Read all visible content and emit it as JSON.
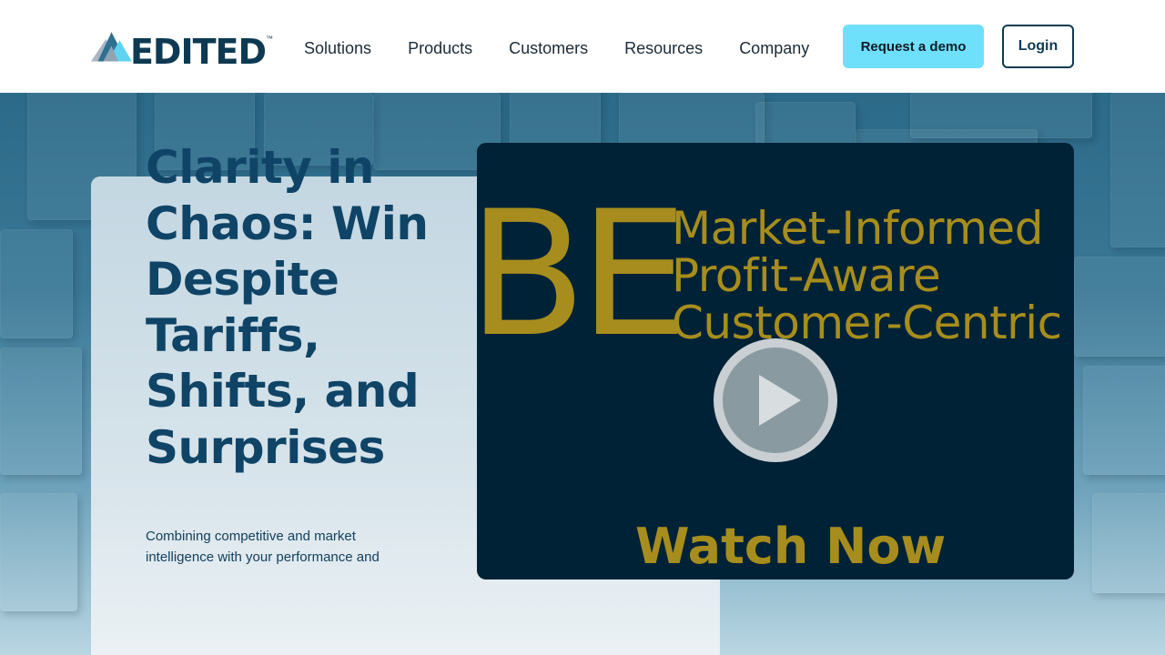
{
  "brand": {
    "name": "EDITED",
    "trademark": "™"
  },
  "nav": {
    "items": [
      {
        "label": "Solutions"
      },
      {
        "label": "Products"
      },
      {
        "label": "Customers"
      },
      {
        "label": "Resources"
      },
      {
        "label": "Company"
      }
    ]
  },
  "header": {
    "demo_label": "Request a demo",
    "login_label": "Login"
  },
  "hero": {
    "headline": "Clarity in Chaos: Win Despite Tariffs, Shifts, and Surprises",
    "subtext": "Combining competitive and market intelligence with your performance and"
  },
  "video": {
    "big_letters": "BE",
    "taglines": [
      "Market-Informed",
      "Profit-Aware",
      "Customer-Centric"
    ],
    "cta": "Watch Now",
    "play_icon": "play-icon"
  },
  "colors": {
    "accent": "#6fe0fb",
    "brand_navy": "#0d3a52",
    "video_bg": "#002236",
    "video_text": "#a78d1d"
  }
}
